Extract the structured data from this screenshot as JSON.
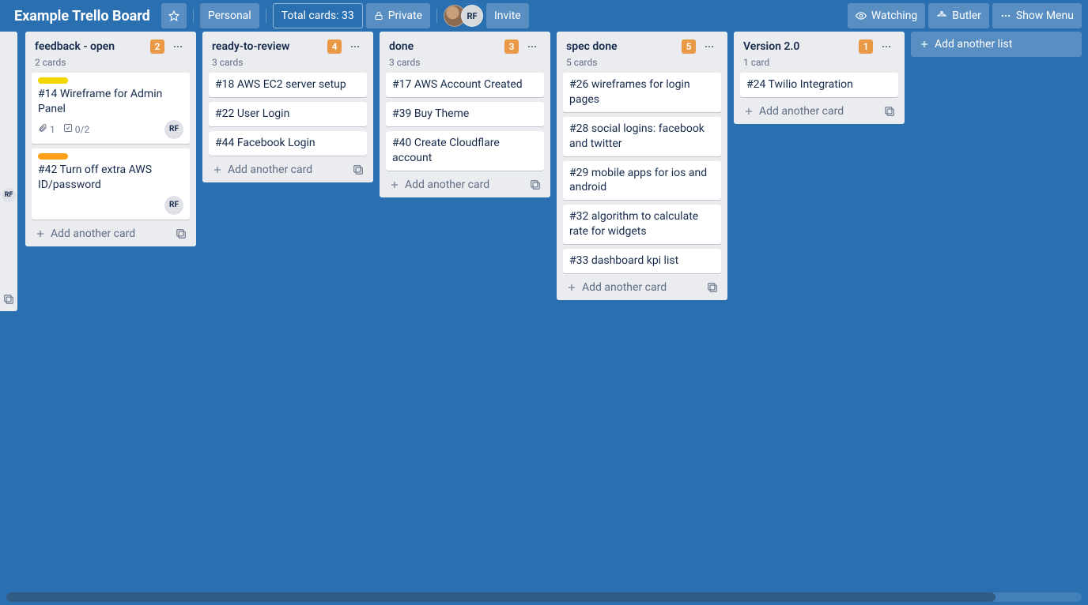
{
  "header": {
    "board_title": "Example Trello Board",
    "personal": "Personal",
    "total_cards": "Total cards: 33",
    "private": "Private",
    "invite": "Invite",
    "watching": "Watching",
    "butler": "Butler",
    "show_menu": "Show Menu",
    "member_initials": "RF"
  },
  "peek": {
    "member": "RF"
  },
  "lists": [
    {
      "name": "feedback - open",
      "badge": "2",
      "subtitle": "2 cards",
      "cards": [
        {
          "label": "yellow",
          "title": "#14 Wireframe for Admin Panel",
          "attachments": "1",
          "checklist": "0/2",
          "member": "RF"
        },
        {
          "label": "orange",
          "title": "#42 Turn off extra AWS ID/password",
          "member": "RF"
        }
      ]
    },
    {
      "name": "ready-to-review",
      "badge": "4",
      "subtitle": "3 cards",
      "cards": [
        {
          "title": "#18 AWS EC2 server setup"
        },
        {
          "title": "#22 User Login"
        },
        {
          "title": "#44 Facebook Login"
        }
      ]
    },
    {
      "name": "done",
      "badge": "3",
      "subtitle": "3 cards",
      "cards": [
        {
          "title": "#17 AWS Account Created"
        },
        {
          "title": "#39 Buy Theme"
        },
        {
          "title": "#40 Create Cloudflare account"
        }
      ]
    },
    {
      "name": "spec done",
      "badge": "5",
      "subtitle": "5 cards",
      "cards": [
        {
          "title": "#26 wireframes for login pages"
        },
        {
          "title": "#28 social logins: facebook and twitter"
        },
        {
          "title": "#29 mobile apps for ios and android"
        },
        {
          "title": "#32 algorithm to calculate rate for widgets"
        },
        {
          "title": "#33 dashboard kpi list"
        }
      ]
    },
    {
      "name": "Version 2.0",
      "badge": "1",
      "subtitle": "1 card",
      "cards": [
        {
          "title": "#24 Twilio Integration"
        }
      ]
    }
  ],
  "common": {
    "add_card": "Add another card",
    "add_list": "Add another list"
  }
}
